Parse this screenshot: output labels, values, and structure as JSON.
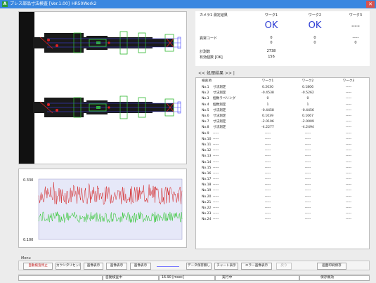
{
  "window": {
    "title": "プレス部品寸法検査 [Ver.1.00]",
    "title2": "HR50Work2",
    "close_icon": "close-icon",
    "app_icon_glyph": "A"
  },
  "summary": {
    "header": [
      "カメラ1 測定結果",
      "ワーク1",
      "ワーク2",
      "ワーク3"
    ],
    "judgement": [
      "OK",
      "OK",
      "---"
    ],
    "result_code_label": "異常コード",
    "result_code_row1": [
      "0",
      "0",
      "-----"
    ],
    "result_code_row2": [
      "0",
      "0",
      "0"
    ],
    "count_label": "計測数",
    "count_value": "2738",
    "time_label": "有効個数 [OK]",
    "time_value": "156"
  },
  "tab": {
    "label": "<< 処理結果 >> |"
  },
  "results": {
    "columns": [
      "検査項目",
      "",
      "ワーク1",
      "ワーク2",
      "ワーク3"
    ],
    "rows": [
      [
        "No.1",
        "寸法測定",
        "0.2030",
        "0.1806",
        "-----"
      ],
      [
        "No.2",
        "寸法測定",
        "-0.4538",
        "-0.5262",
        "-----"
      ],
      [
        "No.3",
        "個数ラベリング",
        "0",
        "0",
        "-----"
      ],
      [
        "No.4",
        "個数測定",
        "1",
        "1",
        "-----"
      ],
      [
        "No.5",
        "寸法測定",
        "-0.4458",
        "-0.4456",
        "-----"
      ],
      [
        "No.6",
        "寸法測定",
        "0.1039",
        "0.1067",
        "-----"
      ],
      [
        "No.7",
        "寸法測定",
        "-2.0106",
        "-2.0009",
        "-----"
      ],
      [
        "No.8",
        "寸法測定",
        "-4.2277",
        "-4.2494",
        "-----"
      ],
      [
        "No.9",
        "-----",
        "-----",
        "-----",
        "-----"
      ],
      [
        "No.10",
        "-----",
        "-----",
        "-----",
        "-----"
      ],
      [
        "No.11",
        "-----",
        "-----",
        "-----",
        "-----"
      ],
      [
        "No.12",
        "-----",
        "-----",
        "-----",
        "-----"
      ],
      [
        "No.13",
        "-----",
        "-----",
        "-----",
        "-----"
      ],
      [
        "No.14",
        "-----",
        "-----",
        "-----",
        "-----"
      ],
      [
        "No.15",
        "-----",
        "-----",
        "-----",
        "-----"
      ],
      [
        "No.16",
        "-----",
        "-----",
        "-----",
        "-----"
      ],
      [
        "No.17",
        "-----",
        "-----",
        "-----",
        "-----"
      ],
      [
        "No.18",
        "-----",
        "-----",
        "-----",
        "-----"
      ],
      [
        "No.19",
        "-----",
        "-----",
        "-----",
        "-----"
      ],
      [
        "No.20",
        "-----",
        "-----",
        "-----",
        "-----"
      ],
      [
        "No.21",
        "-----",
        "-----",
        "-----",
        "-----"
      ],
      [
        "No.22",
        "-----",
        "-----",
        "-----",
        "-----"
      ],
      [
        "No.23",
        "-----",
        "-----",
        "-----",
        "-----"
      ],
      [
        "No.24",
        "-----",
        "-----",
        "-----",
        "-----"
      ]
    ]
  },
  "chart": {
    "ymax_label": "0.330",
    "ymin_label": "0.100",
    "ylim": [
      0.1,
      0.33
    ],
    "series_colors": [
      "#d41c1c",
      "#22c422"
    ],
    "plot_bg": "#e6e8f8"
  },
  "menu": {
    "label": "Menu",
    "buttons": [
      {
        "label": "自動検査停止",
        "style": "red"
      },
      {
        "label": "カウンタリセット",
        "style": "normal"
      },
      {
        "label": "画像表示",
        "style": "normal"
      },
      {
        "label": "画像表示",
        "style": "normal"
      },
      {
        "label": "画像表示",
        "style": "normal"
      },
      {
        "label": "データ保存無し",
        "style": "normal"
      },
      {
        "label": "チャート表示",
        "style": "normal"
      },
      {
        "label": "エラー画像表示",
        "style": "normal"
      },
      {
        "label": "戻り",
        "style": "disabled"
      },
      {
        "label": "画面印刷保存",
        "style": "normal"
      }
    ]
  },
  "status": {
    "mode": "自動検査中",
    "time": "16.90 [msec]",
    "state": "実行中",
    "save": "保存無効"
  }
}
